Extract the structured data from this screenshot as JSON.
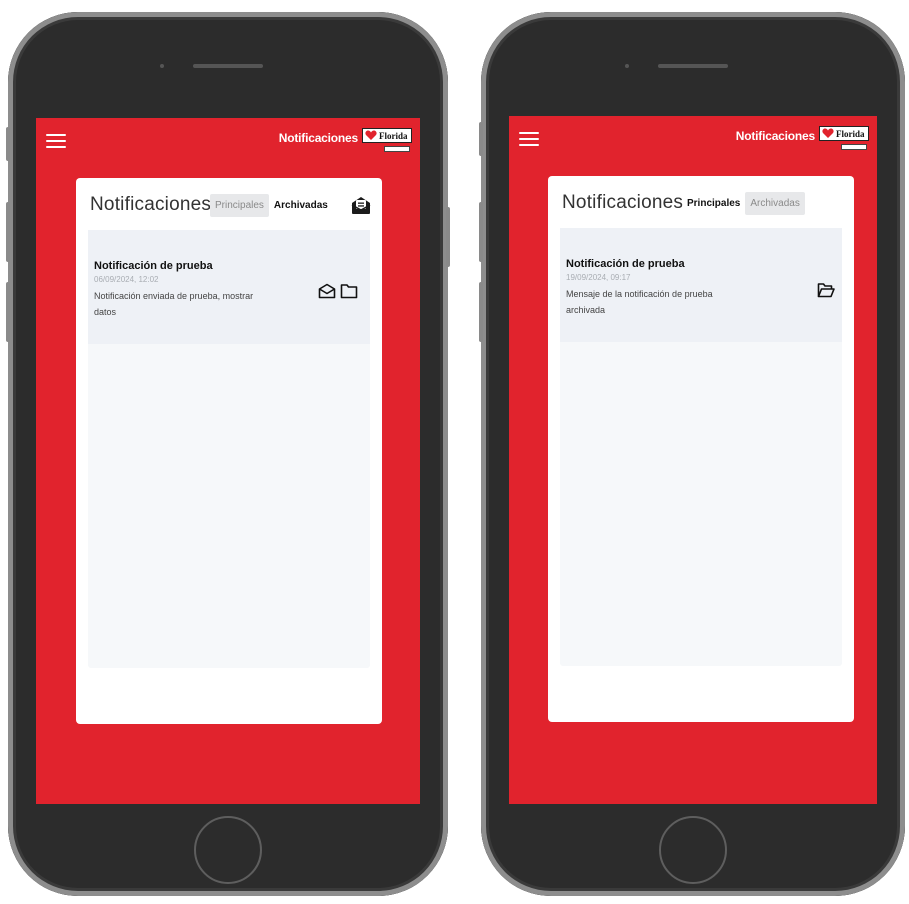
{
  "colors": {
    "brand_red": "#e1232d",
    "bezel": "#2c2c2c",
    "card_bg": "#ffffff",
    "item_bg": "#eef1f6"
  },
  "phones": [
    {
      "appbar": {
        "menu_icon": "hamburger-icon",
        "title": "Notificaciones",
        "brand_name": "Florida"
      },
      "card": {
        "title": "Notificaciones",
        "tabs": [
          {
            "label": "Principales",
            "state": "selected"
          },
          {
            "label": "Archivadas",
            "state": "unselected"
          }
        ],
        "header_icon": "mail-open-icon",
        "notification": {
          "title": "Notificación de prueba",
          "date": "06/09/2024, 12:02",
          "message": "Notificación enviada de prueba, mostrar datos",
          "actions": [
            "mark-read-icon",
            "archive-folder-icon"
          ]
        }
      }
    },
    {
      "appbar": {
        "menu_icon": "hamburger-icon",
        "title": "Notificaciones",
        "brand_name": "Florida"
      },
      "card": {
        "title": "Notificaciones",
        "tabs": [
          {
            "label": "Principales",
            "state": "unselected"
          },
          {
            "label": "Archivadas",
            "state": "selected"
          }
        ],
        "notification": {
          "title": "Notificación de prueba",
          "date": "19/09/2024, 09:17",
          "message": "Mensaje de la notificación de prueba archivada",
          "actions": [
            "unarchive-folder-icon"
          ]
        }
      }
    }
  ]
}
